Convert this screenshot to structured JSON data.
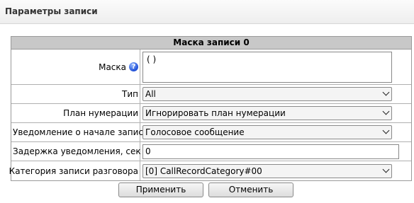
{
  "page": {
    "title": "Параметры записи"
  },
  "grid": {
    "header": "Маска записи 0",
    "mask": {
      "label": "Маска",
      "value": "( )",
      "help": "?"
    },
    "type": {
      "label": "Тип",
      "selected": "All"
    },
    "numbering_plan": {
      "label": "План нумерации",
      "selected": "Игнорировать план нумерации"
    },
    "start_notification": {
      "label": "Уведомление о начале записи",
      "selected": "Голосовое сообщение"
    },
    "notification_delay": {
      "label": "Задержка уведомления, сек",
      "value": "0",
      "help": "?"
    },
    "record_category": {
      "label": "Категория записи разговора",
      "selected": "[0] CallRecordCategory#00"
    }
  },
  "buttons": {
    "apply": "Применить",
    "cancel": "Отменить"
  },
  "icons": {
    "help": "help-icon",
    "dropdown": "chevron-down-icon"
  },
  "colors": {
    "header_bg": "#c8c8c8",
    "help_icon": "#1f4fd6"
  }
}
